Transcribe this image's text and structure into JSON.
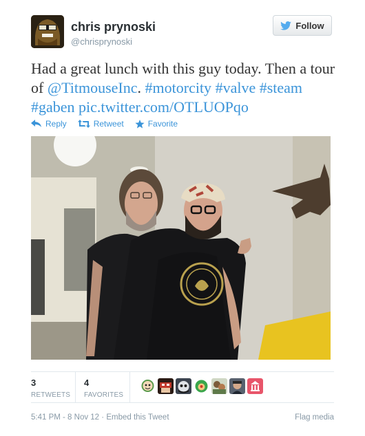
{
  "author": {
    "name": "chris prynoski",
    "handle": "@chrisprynoski"
  },
  "follow_button": {
    "label": "Follow",
    "icon": "twitter-bird-icon"
  },
  "tweet": {
    "text_plain_1": "Had a great lunch with this guy today. Then a tour of ",
    "mention": "@TitmouseInc",
    "text_plain_2": ". ",
    "hashtags": [
      "#motorcity",
      "#valve",
      "#steam",
      "#gaben"
    ],
    "pic_link": "pic.twitter.com/OTLUOPqo"
  },
  "actions": {
    "reply": "Reply",
    "retweet": "Retweet",
    "favorite": "Favorite"
  },
  "stats": {
    "retweets_count": "3",
    "retweets_label": "RETWEETS",
    "favorites_count": "4",
    "favorites_label": "FAVORITES"
  },
  "footer": {
    "timestamp": "5:41 PM - 8 Nov 12",
    "embed": "Embed this Tweet",
    "flag": "Flag media"
  },
  "colors": {
    "link": "#3b94d9",
    "muted": "#8899a6",
    "text": "#292f33"
  }
}
